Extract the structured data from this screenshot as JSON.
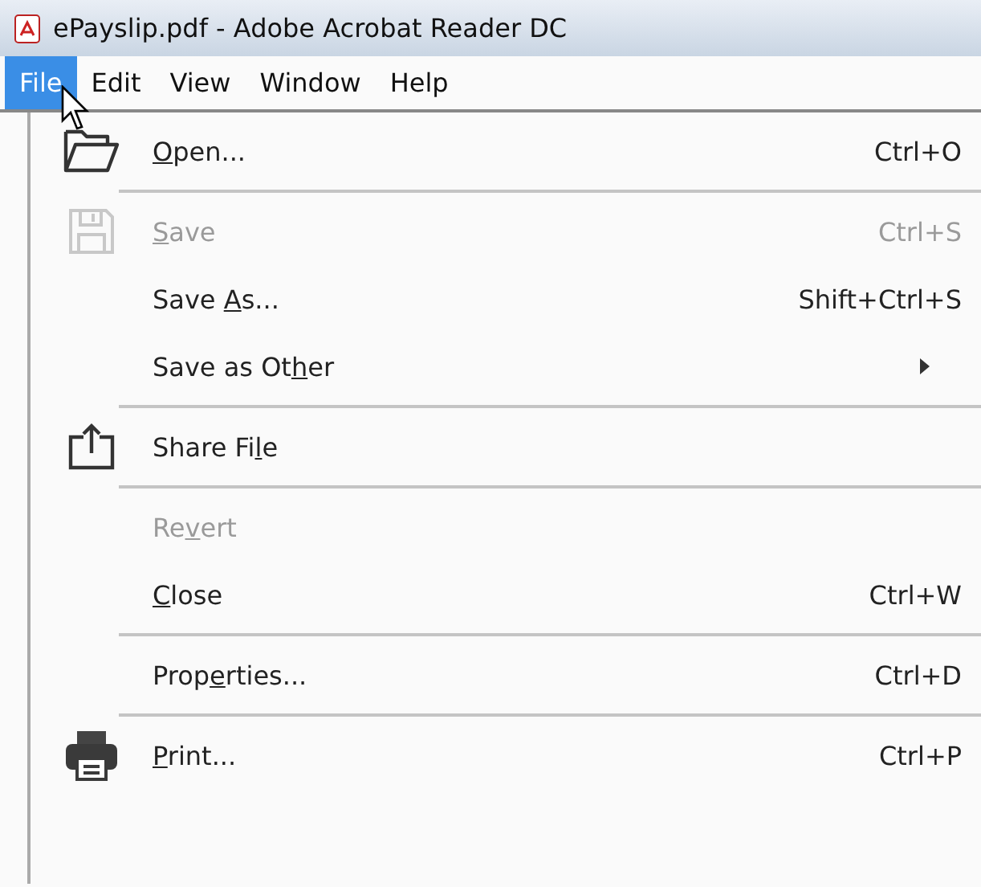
{
  "window": {
    "title": "ePayslip.pdf - Adobe Acrobat Reader DC"
  },
  "menubar": [
    {
      "label": "File",
      "selected": true
    },
    {
      "label": "Edit",
      "selected": false
    },
    {
      "label": "View",
      "selected": false
    },
    {
      "label": "Window",
      "selected": false
    },
    {
      "label": "Help",
      "selected": false
    }
  ],
  "menu": {
    "groups": [
      [
        {
          "kind": "open",
          "label": [
            {
              "text": "O",
              "underlined": true
            },
            {
              "text": "pen...",
              "underlined": false
            }
          ],
          "shortcut": "Ctrl+O",
          "disabled": false
        }
      ],
      [
        {
          "kind": "save",
          "label": [
            {
              "text": "S",
              "underlined": true
            },
            {
              "text": "ave",
              "underlined": false
            }
          ],
          "shortcut": "Ctrl+S",
          "disabled": true
        },
        {
          "kind": "plain",
          "label": [
            {
              "text": "Save ",
              "underlined": false
            },
            {
              "text": "A",
              "underlined": true
            },
            {
              "text": "s...",
              "underlined": false
            }
          ],
          "shortcut": "Shift+Ctrl+S",
          "disabled": false
        },
        {
          "kind": "plain",
          "label": [
            {
              "text": "Save as Ot",
              "underlined": false
            },
            {
              "text": "h",
              "underlined": true
            },
            {
              "text": "er",
              "underlined": false
            }
          ],
          "submenu": true,
          "disabled": false
        }
      ],
      [
        {
          "kind": "share",
          "label": [
            {
              "text": "Share Fi",
              "underlined": false
            },
            {
              "text": "l",
              "underlined": true
            },
            {
              "text": "e",
              "underlined": false
            }
          ],
          "disabled": false
        }
      ],
      [
        {
          "kind": "plain",
          "label": [
            {
              "text": "Re",
              "underlined": false
            },
            {
              "text": "v",
              "underlined": true
            },
            {
              "text": "ert",
              "underlined": false
            }
          ],
          "disabled": true
        },
        {
          "kind": "plain",
          "label": [
            {
              "text": "C",
              "underlined": true
            },
            {
              "text": "lose",
              "underlined": false
            }
          ],
          "shortcut": "Ctrl+W",
          "disabled": false
        }
      ],
      [
        {
          "kind": "plain",
          "label": [
            {
              "text": "Prop",
              "underlined": false
            },
            {
              "text": "e",
              "underlined": true
            },
            {
              "text": "rties...",
              "underlined": false
            }
          ],
          "shortcut": "Ctrl+D",
          "disabled": false
        }
      ],
      [
        {
          "kind": "print",
          "label": [
            {
              "text": "P",
              "underlined": true
            },
            {
              "text": "rint...",
              "underlined": false
            }
          ],
          "shortcut": "Ctrl+P",
          "disabled": false
        }
      ]
    ]
  }
}
